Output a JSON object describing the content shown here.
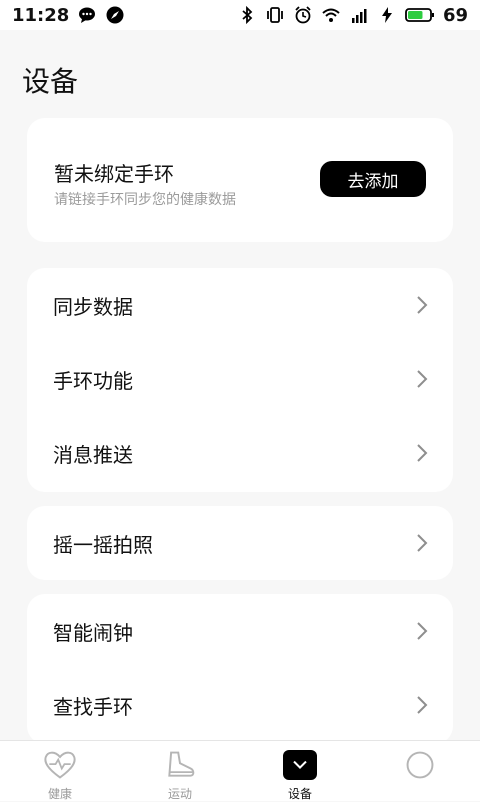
{
  "status_bar": {
    "time": "11:28",
    "battery_percent": "69",
    "battery_level": 0.69,
    "icons_left": [
      "chat-icon",
      "compass-icon"
    ],
    "icons_right": [
      "bluetooth-icon",
      "vibrate-icon",
      "alarm-icon",
      "wifi-icon",
      "cellular-4g-icon",
      "charging-icon",
      "battery-icon"
    ]
  },
  "page": {
    "title": "设备"
  },
  "bind_card": {
    "title": "暂未绑定手环",
    "subtitle": "请链接手环同步您的健康数据",
    "button_label": "去添加"
  },
  "menu": {
    "group1": [
      {
        "label": "同步数据"
      },
      {
        "label": "手环功能"
      },
      {
        "label": "消息推送"
      }
    ],
    "group2": [
      {
        "label": "摇一摇拍照"
      }
    ],
    "group3": [
      {
        "label": "智能闹钟"
      },
      {
        "label": "查找手环"
      }
    ]
  },
  "tabs": [
    {
      "label": "健康",
      "icon": "heart-icon",
      "active": false
    },
    {
      "label": "运动",
      "icon": "shoe-icon",
      "active": false
    },
    {
      "label": "设备",
      "icon": "device-icon",
      "active": true
    },
    {
      "label": "",
      "icon": "profile-icon",
      "active": false
    }
  ],
  "colors": {
    "accent": "#000000",
    "battery": "#2ecc40",
    "background": "#f7f7f7"
  }
}
